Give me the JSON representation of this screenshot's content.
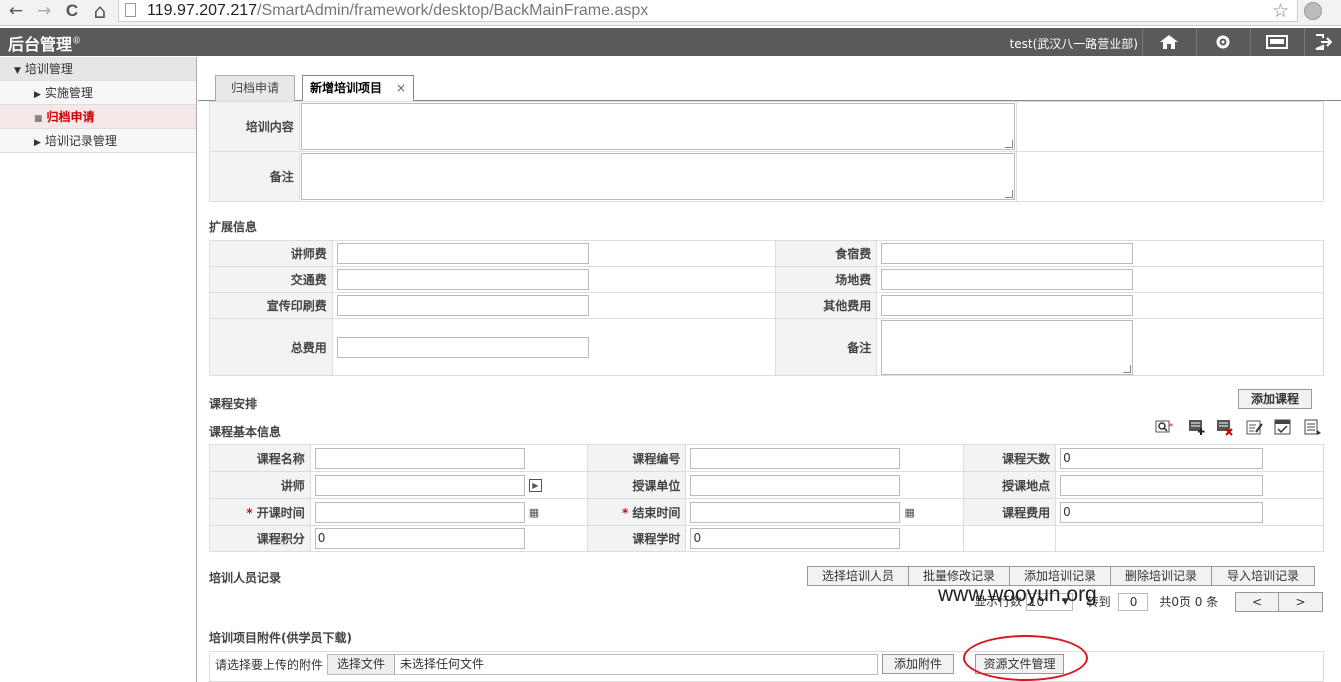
{
  "browser": {
    "back": "←",
    "forward": "→",
    "reload": "C",
    "home": "⌂",
    "url_host": "119.97.207.217",
    "url_path": "/SmartAdmin/framework/desktop/BackMainFrame.aspx"
  },
  "header": {
    "title": "后台管理",
    "reg": "®",
    "user": "test(武汉八一路营业部)"
  },
  "sidebar": {
    "group": "培训管理",
    "items": [
      {
        "label": "实施管理"
      },
      {
        "label": "归档申请"
      },
      {
        "label": "培训记录管理"
      }
    ]
  },
  "tabs": [
    {
      "label": "归档申请"
    },
    {
      "label": "新增培训项目",
      "close": "×"
    }
  ],
  "basic": {
    "content_label": "培训内容",
    "remark_label": "备注"
  },
  "ext": {
    "title": "扩展信息",
    "teacher_fee": "讲师费",
    "food_fee": "食宿费",
    "traffic_fee": "交通费",
    "venue_fee": "场地费",
    "print_fee": "宣传印刷费",
    "other_fee": "其他费用",
    "total_fee": "总费用",
    "remark": "备注"
  },
  "course": {
    "title": "课程安排",
    "add_btn": "添加课程",
    "basic_title": "课程基本信息",
    "name": "课程名称",
    "code": "课程编号",
    "days": "课程天数",
    "days_val": "0",
    "teacher": "讲师",
    "unit": "授课单位",
    "place": "授课地点",
    "start": "开课时间",
    "end": "结束时间",
    "fee": "课程费用",
    "fee_val": "0",
    "credit": "课程积分",
    "credit_val": "0",
    "hours": "课程学时",
    "hours_val": "0",
    "req": "*"
  },
  "records": {
    "title": "培训人员记录",
    "buttons": [
      "选择培训人员",
      "批量修改记录",
      "添加培训记录",
      "删除培训记录",
      "导入培训记录"
    ],
    "rows_label": "显示行数",
    "rows_val": "10",
    "goto_label": "转到",
    "goto_val": "0",
    "summary": "共0页 0 条",
    "prev": "<",
    "next": ">"
  },
  "attach": {
    "title": "培训项目附件(供学员下载)",
    "upload_label": "请选择要上传的附件",
    "choose_btn": "选择文件",
    "no_file": "未选择任何文件",
    "add_btn": "添加附件",
    "res_btn": "资源文件管理"
  },
  "watermark": "www.wooyun.org",
  "colors": {
    "header_bg": "#5a5a5a",
    "accent_red": "#d9161c"
  }
}
